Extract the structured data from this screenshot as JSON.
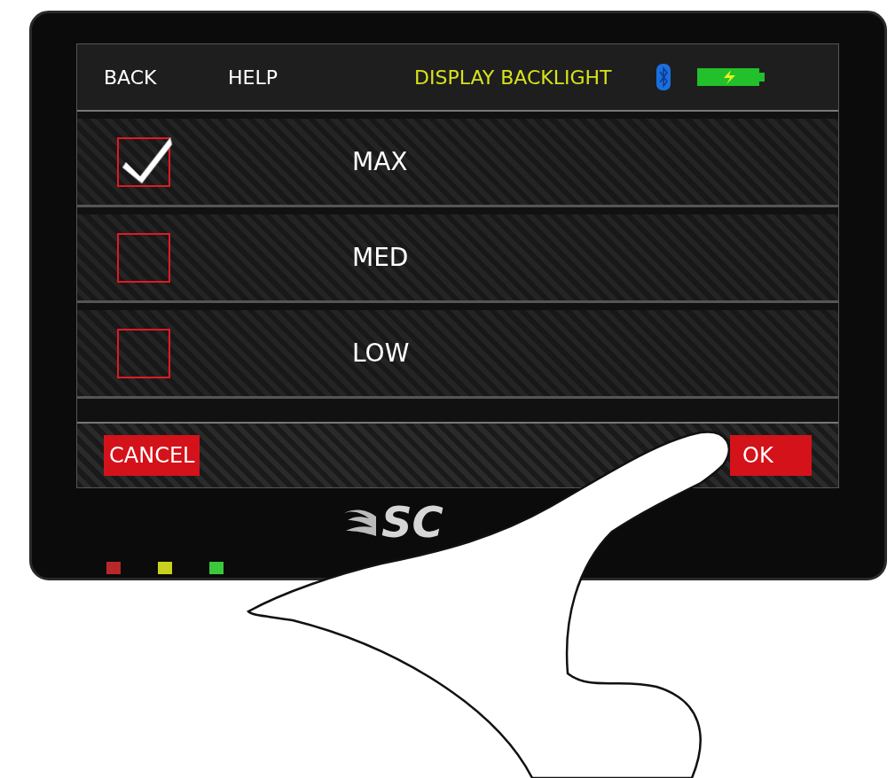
{
  "top_bar": {
    "back_button": "BACK",
    "help_button": "HELP",
    "title": "DISPLAY BACKLIGHT"
  },
  "options": [
    {
      "label": "MAX",
      "checked": true
    },
    {
      "label": "MED",
      "checked": false
    },
    {
      "label": "LOW",
      "checked": false
    }
  ],
  "buttons": {
    "cancel": "CANCEL",
    "ok": "OK"
  },
  "logo": "SC",
  "leds": [
    {
      "color": "#b8282b"
    },
    {
      "color": "#c8d21e"
    },
    {
      "color": "#3cc83c"
    }
  ]
}
